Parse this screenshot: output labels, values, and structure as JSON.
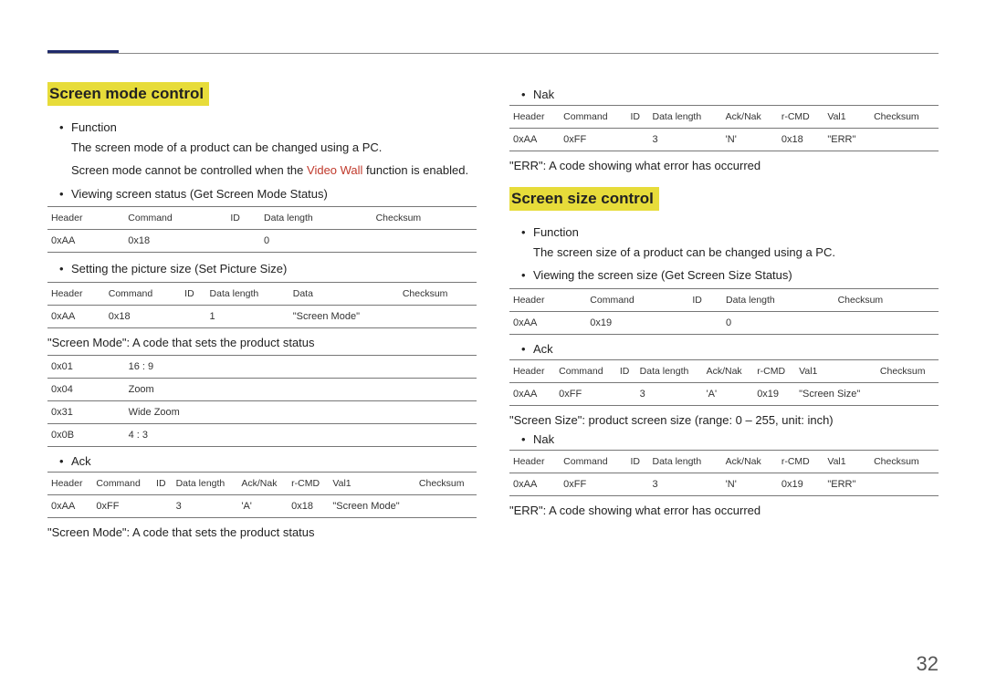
{
  "pageNumber": "32",
  "left": {
    "heading": "Screen mode control",
    "func_label": "Function",
    "func_line1": "The screen mode of a product can be changed using a PC.",
    "func_line2a": "Screen mode cannot be controlled when the ",
    "func_line2_link": "Video Wall",
    "func_line2b": " function is enabled.",
    "view_label": "Viewing screen status (Get Screen Mode Status)",
    "t1": {
      "headers": [
        "Header",
        "Command",
        "ID",
        "Data length",
        "Checksum"
      ],
      "row": [
        "0xAA",
        "0x18",
        "",
        "0",
        ""
      ]
    },
    "set_label": "Setting the picture size (Set Picture Size)",
    "t2": {
      "headers": [
        "Header",
        "Command",
        "ID",
        "Data length",
        "Data",
        "Checksum"
      ],
      "row": [
        "0xAA",
        "0x18",
        "",
        "1",
        "\"Screen Mode\"",
        ""
      ]
    },
    "caption1": "\"Screen Mode\": A code that sets the product status",
    "modes": [
      [
        "0x01",
        "16 : 9"
      ],
      [
        "0x04",
        "Zoom"
      ],
      [
        "0x31",
        "Wide Zoom"
      ],
      [
        "0x0B",
        "4 : 3"
      ]
    ],
    "ack_label": "Ack",
    "t3": {
      "headers": [
        "Header",
        "Command",
        "ID",
        "Data length",
        "Ack/Nak",
        "r-CMD",
        "Val1",
        "Checksum"
      ],
      "row": [
        "0xAA",
        "0xFF",
        "",
        "3",
        "'A'",
        "0x18",
        "\"Screen Mode\"",
        ""
      ]
    },
    "caption2": "\"Screen Mode\": A code that sets the product status"
  },
  "right": {
    "nak_label": "Nak",
    "t4": {
      "headers": [
        "Header",
        "Command",
        "ID",
        "Data length",
        "Ack/Nak",
        "r-CMD",
        "Val1",
        "Checksum"
      ],
      "row": [
        "0xAA",
        "0xFF",
        "",
        "3",
        "'N'",
        "0x18",
        "\"ERR\"",
        ""
      ]
    },
    "err_caption": "\"ERR\": A code showing what error has occurred",
    "heading": "Screen size control",
    "func_label": "Function",
    "func_line1": "The screen size of a product can be changed using a PC.",
    "view_label": "Viewing the screen size (Get Screen Size Status)",
    "t5": {
      "headers": [
        "Header",
        "Command",
        "ID",
        "Data length",
        "Checksum"
      ],
      "row": [
        "0xAA",
        "0x19",
        "",
        "0",
        ""
      ]
    },
    "ack_label": "Ack",
    "t6": {
      "headers": [
        "Header",
        "Command",
        "ID",
        "Data length",
        "Ack/Nak",
        "r-CMD",
        "Val1",
        "Checksum"
      ],
      "row": [
        "0xAA",
        "0xFF",
        "",
        "3",
        "'A'",
        "0x19",
        "\"Screen Size\"",
        ""
      ]
    },
    "size_caption": "\"Screen Size\": product screen size (range: 0 – 255, unit: inch)",
    "nak2_label": "Nak",
    "t7": {
      "headers": [
        "Header",
        "Command",
        "ID",
        "Data length",
        "Ack/Nak",
        "r-CMD",
        "Val1",
        "Checksum"
      ],
      "row": [
        "0xAA",
        "0xFF",
        "",
        "3",
        "'N'",
        "0x19",
        "\"ERR\"",
        ""
      ]
    },
    "err_caption2": "\"ERR\": A code showing what error has occurred"
  }
}
